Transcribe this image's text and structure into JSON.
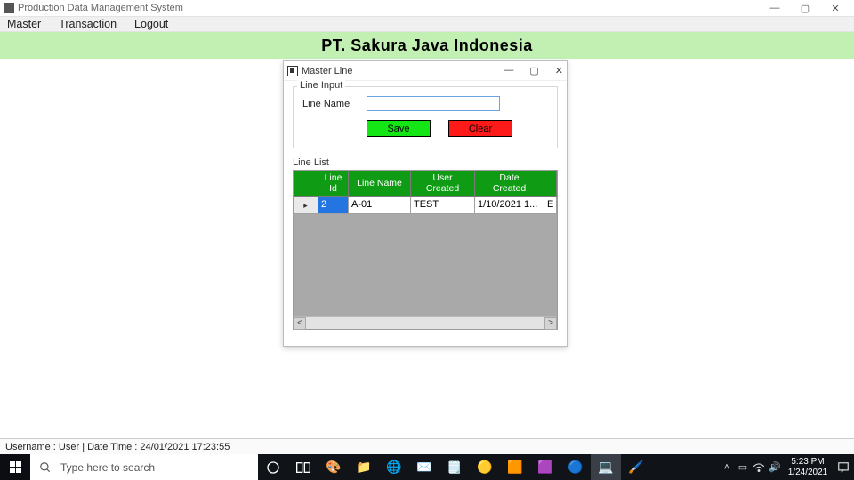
{
  "window": {
    "title": "Production Data Management System",
    "minimize": "—",
    "maximize": "▢",
    "close": "✕"
  },
  "menu": {
    "master": "Master",
    "transaction": "Transaction",
    "logout": "Logout"
  },
  "banner": "PT. Sakura Java Indonesia",
  "status": "Username :  User   |   Date Time :   24/01/2021 17:23:55",
  "child": {
    "title": "Master Line",
    "minimize": "—",
    "maximize": "▢",
    "close": "✕",
    "fieldset_legend": "Line Input",
    "line_name_label": "Line Name",
    "line_name_value": "",
    "save": "Save",
    "clear": "Clear",
    "list_label": "Line List",
    "columns": {
      "id": "Line\nId",
      "name": "Line Name",
      "user": "User\nCreated",
      "date": "Date\nCreated"
    },
    "rows": [
      {
        "id": "2",
        "name": "A-01",
        "user": "TEST",
        "date": "1/10/2021 1...",
        "extra": "E"
      }
    ],
    "scroll_left": "<",
    "scroll_right": ">"
  },
  "taskbar": {
    "search_placeholder": "Type here to search",
    "clock_time": "5:23 PM",
    "clock_date": "1/24/2021"
  }
}
